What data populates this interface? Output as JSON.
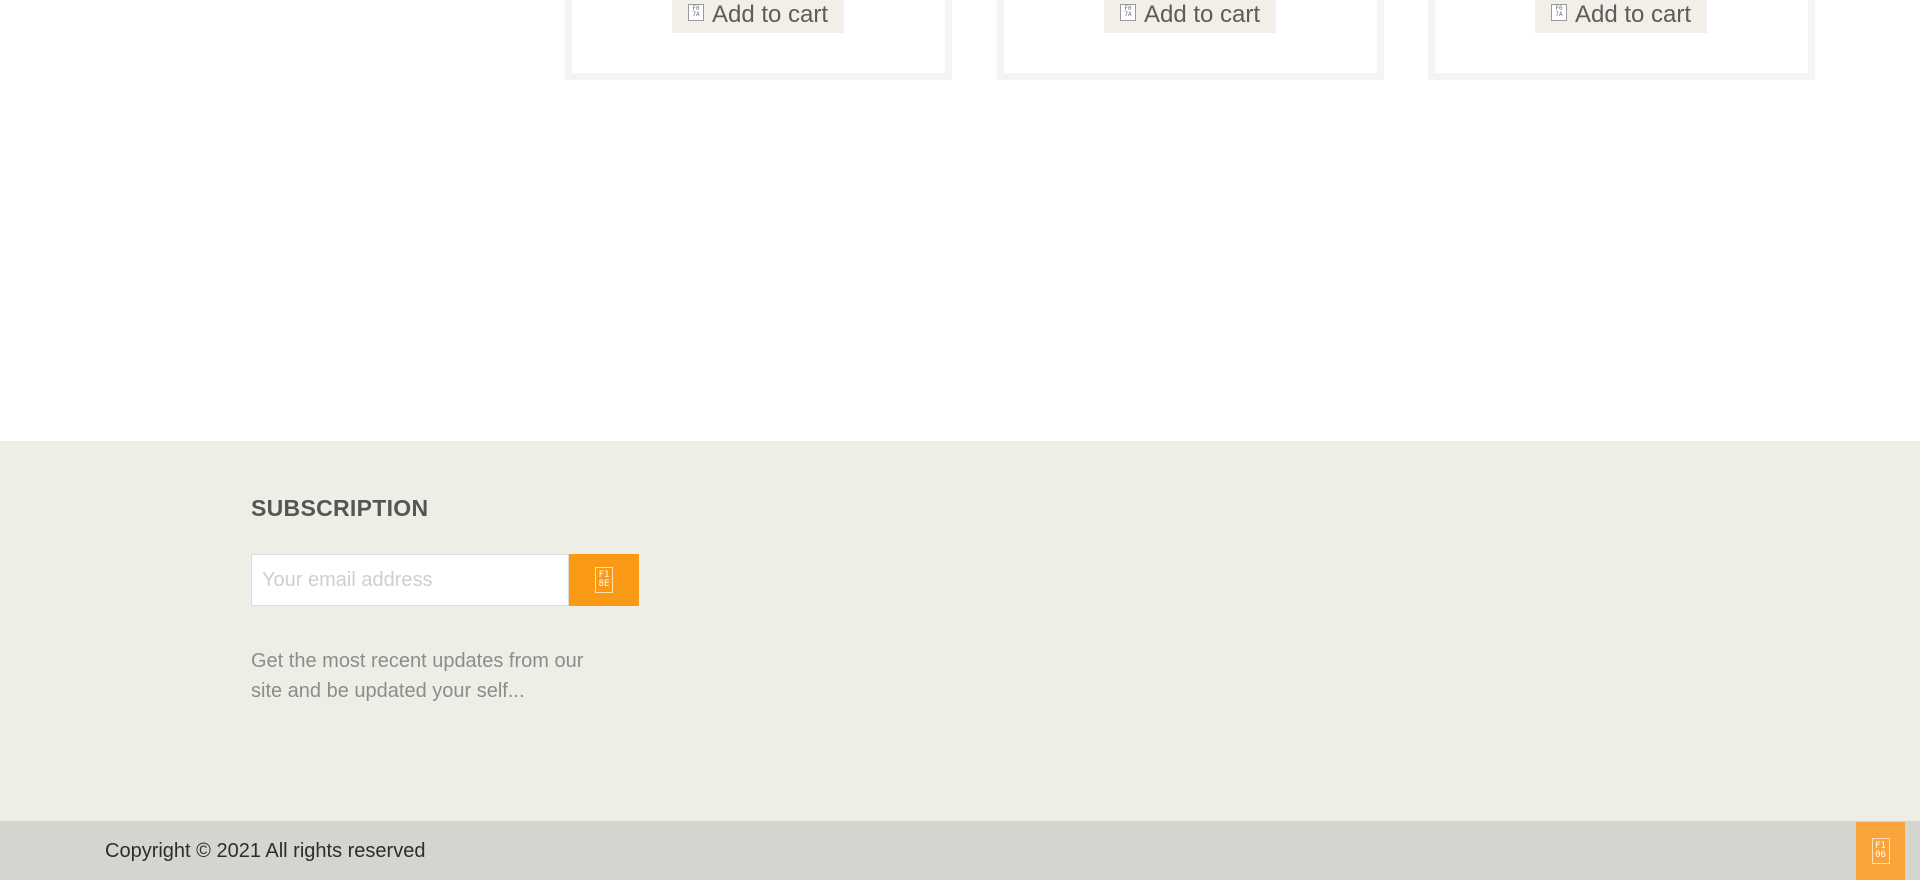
{
  "products": [
    {
      "cart_label": "Add to cart",
      "cart_icon": "cart-icon",
      "icon_top": "F0",
      "icon_bottom": "7A"
    },
    {
      "cart_label": "Add to cart",
      "cart_icon": "cart-icon",
      "icon_top": "F0",
      "icon_bottom": "7A"
    },
    {
      "cart_label": "Add to cart",
      "cart_icon": "cart-icon",
      "icon_top": "F0",
      "icon_bottom": "7A"
    }
  ],
  "subscription": {
    "title": "SUBSCRIPTION",
    "email_placeholder": "Your email address",
    "email_value": "",
    "submit_icon": "submit-icon",
    "submit_icon_top": "F1",
    "submit_icon_bottom": "8E",
    "description": "Get the most recent updates from our site and be updated your self..."
  },
  "footer": {
    "copyright": "Copyright © 2021 All rights reserved",
    "back_to_top_icon": "arrow-up-icon",
    "back_to_top_icon_top": "F1",
    "back_to_top_icon_bottom": "06"
  },
  "colors": {
    "accent": "#fa9a14",
    "subscription_bg": "#efeee6",
    "footer_bg": "#d5d5cf",
    "button_bg": "#f1efe8"
  }
}
